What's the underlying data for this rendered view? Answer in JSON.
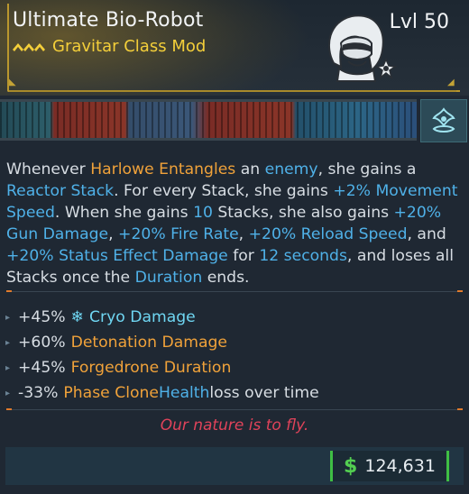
{
  "item": {
    "name": "Ultimate Bio-Robot",
    "type_label": "Gravitar Class Mod",
    "level_label": "Lvl 50",
    "rarity_color": "#f4cf3a",
    "portrait_icon": "gravitar-portrait-icon",
    "element_icon": "element-badge-icon"
  },
  "description": {
    "segments": [
      {
        "t": "Whenever ",
        "c": ""
      },
      {
        "t": "Harlowe Entangles",
        "c": "o"
      },
      {
        "t": " an ",
        "c": ""
      },
      {
        "t": "enemy",
        "c": "b"
      },
      {
        "t": ", she gains a ",
        "c": ""
      },
      {
        "t": "Reactor Stack",
        "c": "b"
      },
      {
        "t": ". For every Stack, she gains ",
        "c": ""
      },
      {
        "t": "+2% Movement Speed",
        "c": "b"
      },
      {
        "t": ". When she gains ",
        "c": ""
      },
      {
        "t": "10",
        "c": "b"
      },
      {
        "t": " Stacks, she also gains ",
        "c": ""
      },
      {
        "t": "+20% Gun Damage",
        "c": "b"
      },
      {
        "t": ", ",
        "c": ""
      },
      {
        "t": "+20% Fire Rate",
        "c": "b"
      },
      {
        "t": ", ",
        "c": ""
      },
      {
        "t": "+20% Reload Speed",
        "c": "b"
      },
      {
        "t": ", and ",
        "c": ""
      },
      {
        "t": "+20% Status Effect Damage",
        "c": "b"
      },
      {
        "t": " for ",
        "c": ""
      },
      {
        "t": "12 seconds",
        "c": "b"
      },
      {
        "t": ", and loses all Stacks once the ",
        "c": ""
      },
      {
        "t": "Duration",
        "c": "b"
      },
      {
        "t": " ends.",
        "c": ""
      }
    ]
  },
  "stats": [
    {
      "value": "+45%",
      "parts": [
        {
          "t": "Cryo Damage",
          "c": "cryo"
        }
      ],
      "icon": "snowflake-icon"
    },
    {
      "value": "+60%",
      "parts": [
        {
          "t": "Detonation Damage",
          "c": "o"
        }
      ]
    },
    {
      "value": "+45%",
      "parts": [
        {
          "t": "Forgedrone Duration",
          "c": "o"
        }
      ]
    },
    {
      "value": "-33%",
      "parts": [
        {
          "t": "Phase Clone",
          "c": "o"
        },
        {
          "t": " ",
          "c": ""
        },
        {
          "t": "Health",
          "c": "b"
        },
        {
          "t": " loss over time",
          "c": ""
        }
      ]
    }
  ],
  "flavor": "Our nature is to fly.",
  "price": {
    "currency_icon": "dollar-icon",
    "symbol": "$",
    "amount": "124,631"
  },
  "colors": {
    "orange": "#f0a23a",
    "blue": "#4fb1e8",
    "cryo": "#6fd6f2",
    "flavor": "#e0435a",
    "money": "#53cf51"
  }
}
